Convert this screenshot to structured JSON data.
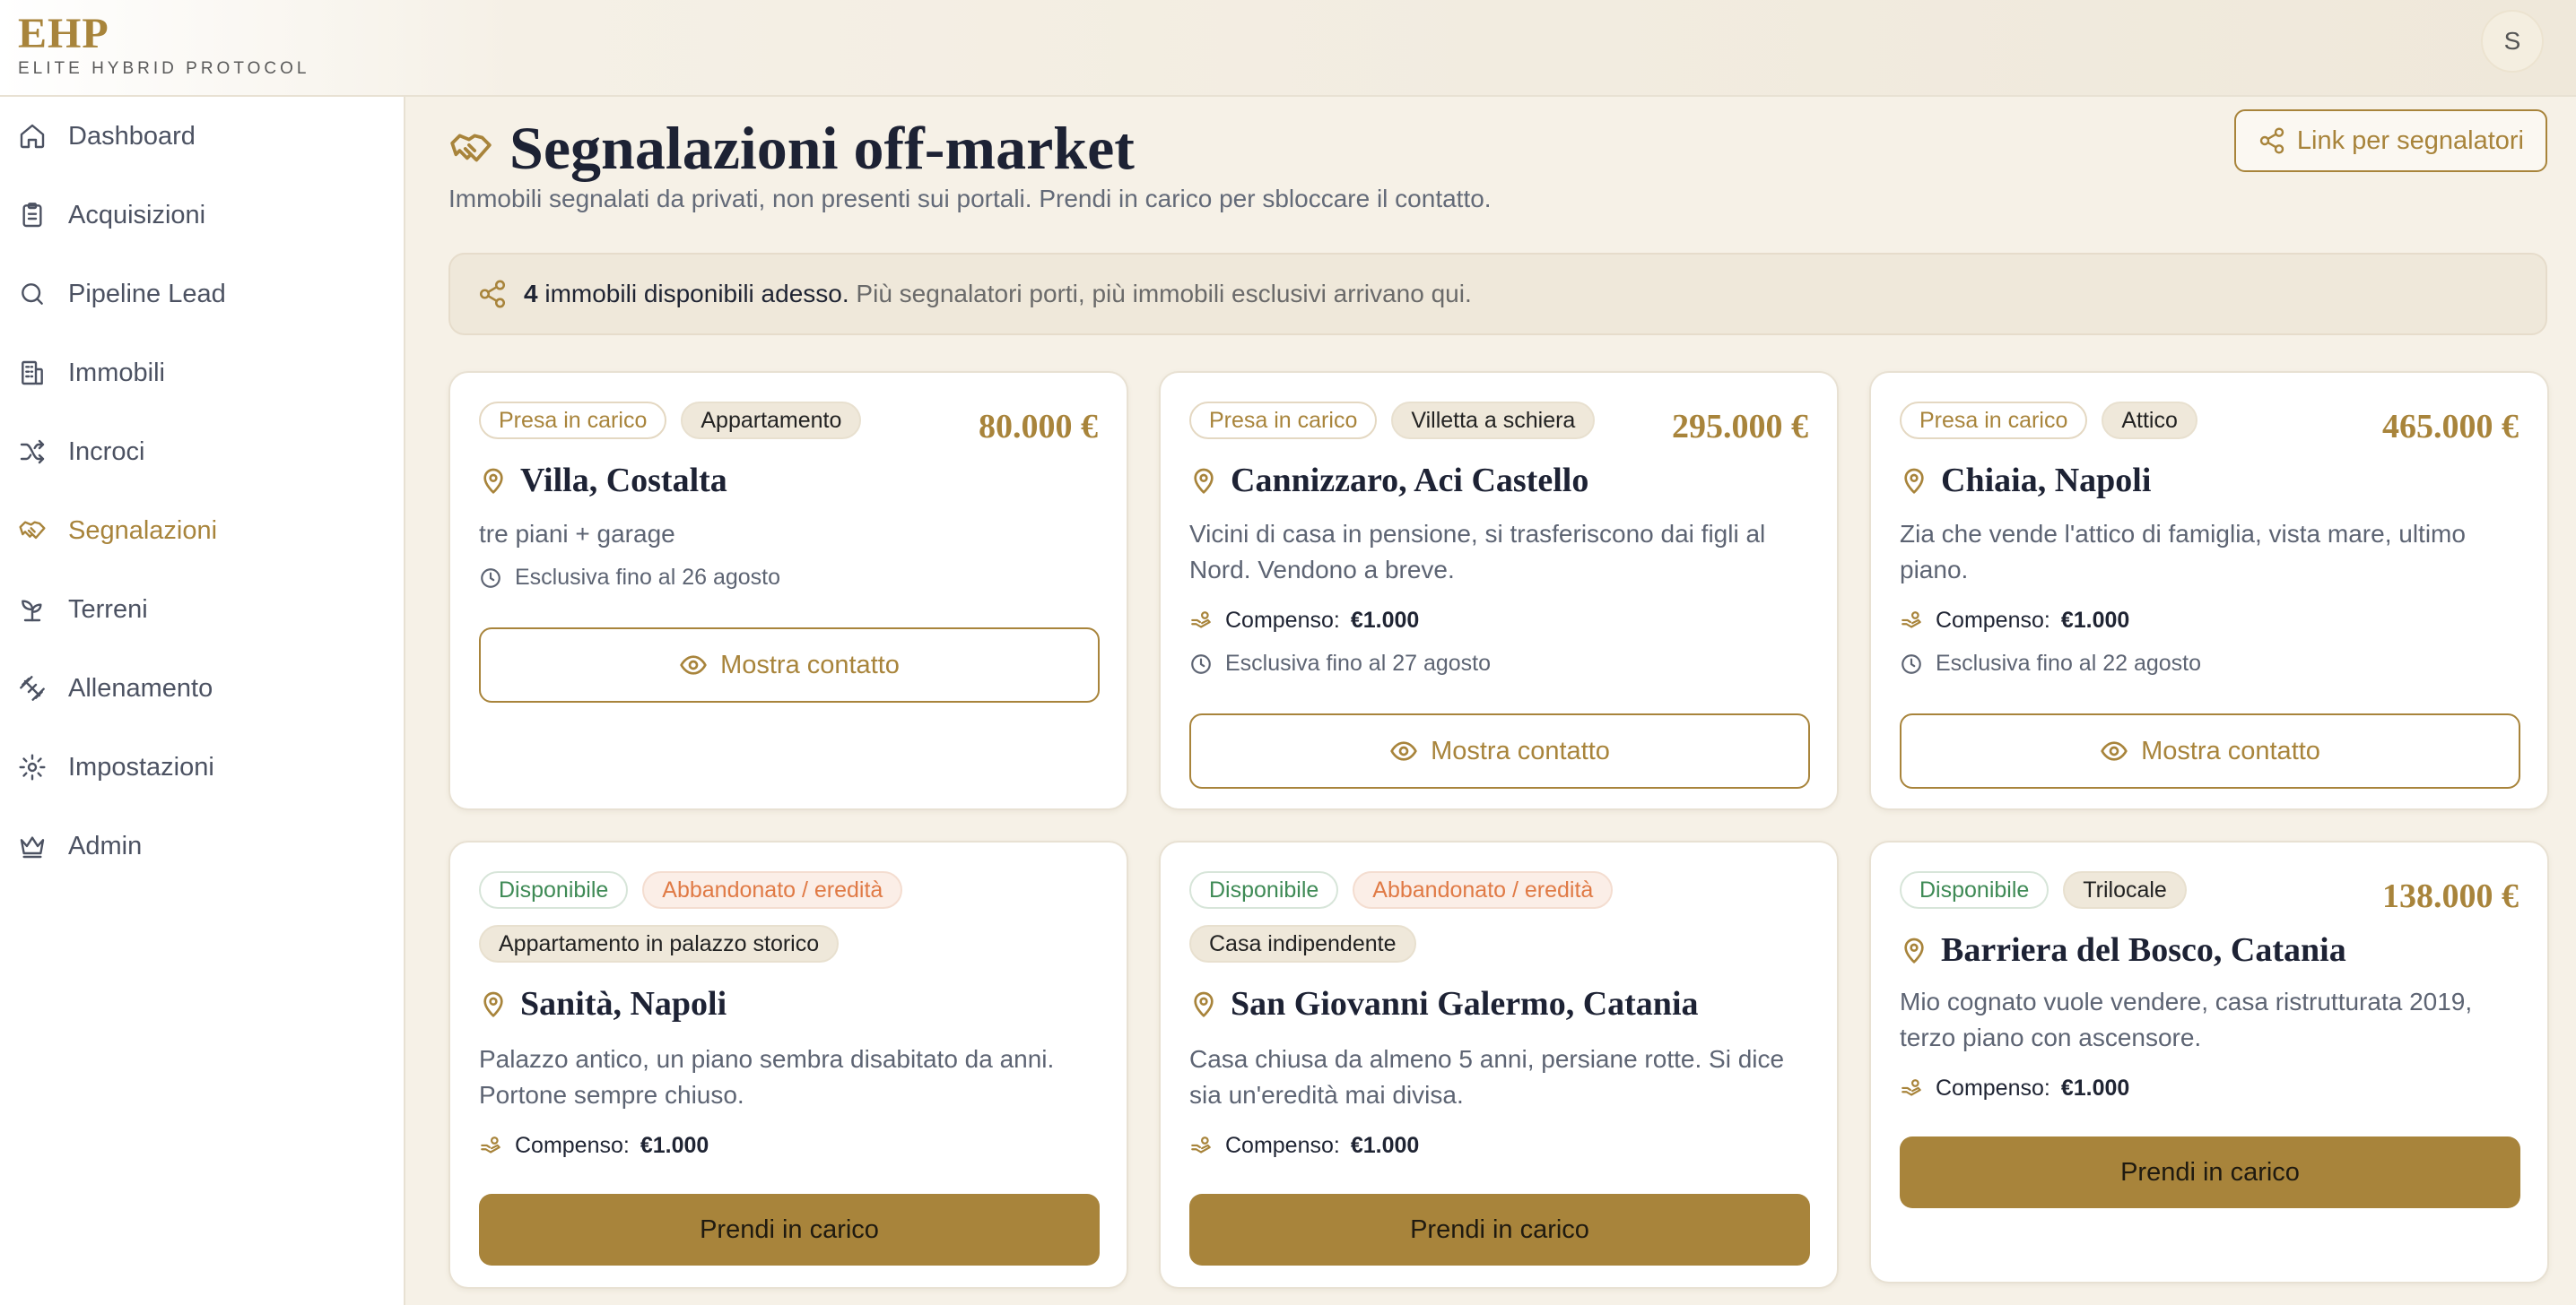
{
  "brand": {
    "logo": "EHP",
    "subtitle": "ELITE HYBRID PROTOCOL"
  },
  "user": {
    "initial": "S"
  },
  "colors": {
    "accent": "#a8843b",
    "available": "#3e8a55",
    "abandoned": "#e07a45"
  },
  "sidebar": {
    "items": [
      {
        "label": "Dashboard",
        "icon": "home-icon",
        "active": false
      },
      {
        "label": "Acquisizioni",
        "icon": "clipboard-icon",
        "active": false
      },
      {
        "label": "Pipeline Lead",
        "icon": "search-icon",
        "active": false
      },
      {
        "label": "Immobili",
        "icon": "building-icon",
        "active": false
      },
      {
        "label": "Incroci",
        "icon": "shuffle-icon",
        "active": false
      },
      {
        "label": "Segnalazioni",
        "icon": "handshake-icon",
        "active": true
      },
      {
        "label": "Terreni",
        "icon": "sprout-icon",
        "active": false
      },
      {
        "label": "Allenamento",
        "icon": "dumbbell-icon",
        "active": false
      },
      {
        "label": "Impostazioni",
        "icon": "gear-icon",
        "active": false
      },
      {
        "label": "Admin",
        "icon": "crown-icon",
        "active": false
      }
    ]
  },
  "page": {
    "title": "Segnalazioni off-market",
    "subtitle": "Immobili segnalati da privati, non presenti sui portali. Prendi in carico per sbloccare il contatto.",
    "link_button": "Link per segnalatori"
  },
  "banner": {
    "count": "4",
    "lead": "immobili disponibili adesso.",
    "rest": "Più segnalatori porti, più immobili esclusivi arrivano qui."
  },
  "cards": [
    {
      "status": "Presa in carico",
      "type": "Appartamento",
      "price": "80.000 €",
      "title": "Villa, Costalta",
      "description": "tre piani + garage",
      "exclusive": "Esclusiva fino al 26 agosto",
      "action": "Mostra contatto"
    },
    {
      "status": "Presa in carico",
      "type": "Villetta a schiera",
      "price": "295.000 €",
      "title": "Cannizzaro, Aci Castello",
      "description": "Vicini di casa in pensione, si trasferiscono dai figli al Nord. Vendono a breve.",
      "compensation_label": "Compenso:",
      "compensation": "€1.000",
      "exclusive": "Esclusiva fino al 27 agosto",
      "action": "Mostra contatto"
    },
    {
      "status": "Presa in carico",
      "type": "Attico",
      "price": "465.000 €",
      "title": "Chiaia, Napoli",
      "description": "Zia che vende l'attico di famiglia, vista mare, ultimo piano.",
      "compensation_label": "Compenso:",
      "compensation": "€1.000",
      "exclusive": "Esclusiva fino al 22 agosto",
      "action": "Mostra contatto"
    },
    {
      "status": "Disponibile",
      "category": "Abbandonato / eredità",
      "type": "Appartamento in palazzo storico",
      "title": "Sanità, Napoli",
      "description": "Palazzo antico, un piano sembra disabitato da anni. Portone sempre chiuso.",
      "compensation_label": "Compenso:",
      "compensation": "€1.000",
      "action": "Prendi in carico"
    },
    {
      "status": "Disponibile",
      "category": "Abbandonato / eredità",
      "type": "Casa indipendente",
      "title": "San Giovanni Galermo, Catania",
      "description": "Casa chiusa da almeno 5 anni, persiane rotte. Si dice sia un'eredità mai divisa.",
      "compensation_label": "Compenso:",
      "compensation": "€1.000",
      "action": "Prendi in carico"
    },
    {
      "status": "Disponibile",
      "type": "Trilocale",
      "price": "138.000 €",
      "title": "Barriera del Bosco, Catania",
      "description": "Mio cognato vuole vendere, casa ristrutturata 2019, terzo piano con ascensore.",
      "compensation_label": "Compenso:",
      "compensation": "€1.000",
      "action": "Prendi in carico"
    }
  ]
}
